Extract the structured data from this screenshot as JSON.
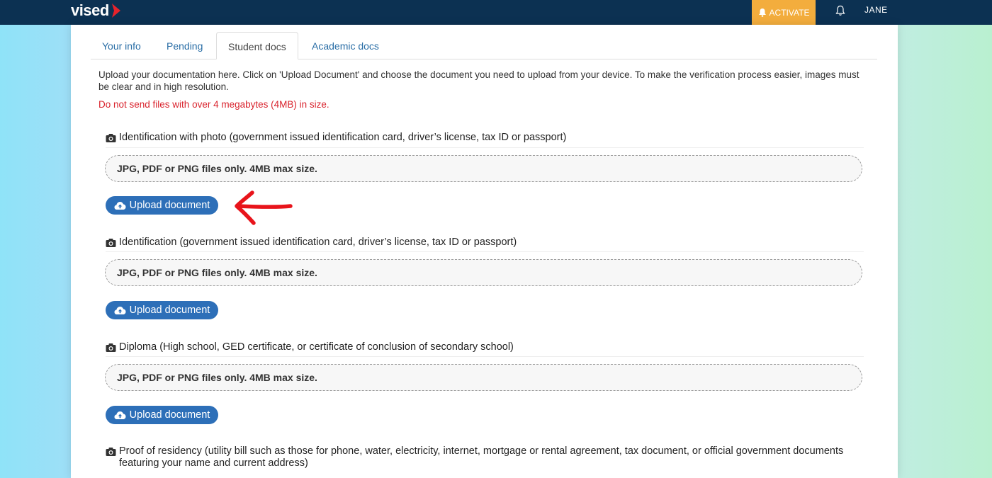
{
  "header": {
    "logo_text": "vised",
    "activate_label": "ACTIVATE",
    "user_name": "JANE"
  },
  "tabs": [
    {
      "label": "Your info",
      "active": false
    },
    {
      "label": "Pending",
      "active": false
    },
    {
      "label": "Student docs",
      "active": true
    },
    {
      "label": "Academic docs",
      "active": false
    }
  ],
  "intro": {
    "text": "Upload your documentation here. Click on 'Upload Document' and choose the document you need to upload from your device. To make the verification process easier, images must be clear and in high resolution.",
    "warning": "Do not send files with over 4 megabytes (4MB) in size."
  },
  "documents": [
    {
      "title": "Identification with photo (government issued identification card, driver’s license, tax ID or passport)",
      "dropzone": "JPG, PDF or PNG files only. 4MB max size.",
      "upload_label": "Upload document"
    },
    {
      "title": "Identification (government issued identification card, driver’s license, tax ID or passport)",
      "dropzone": "JPG, PDF or PNG files only. 4MB max size.",
      "upload_label": "Upload document"
    },
    {
      "title": "Diploma (High school, GED certificate, or certificate of conclusion of secondary school)",
      "dropzone": "JPG, PDF or PNG files only. 4MB max size.",
      "upload_label": "Upload document"
    },
    {
      "title": "Proof of residency (utility bill such as those for phone, water, electricity, internet, mortgage or rental agreement, tax document, or official government documents featuring your name and current address)"
    }
  ],
  "colors": {
    "topbar": "#0c3152",
    "activate": "#f3ad3d",
    "upload_button": "#2d6fb8",
    "warning": "#d9232d",
    "annotation_arrow": "#e8141b"
  },
  "icons": {
    "bell": "bell-icon",
    "camera": "camera-icon",
    "upload": "cloud-upload-icon",
    "logo_chevron": "chevron-right-icon"
  }
}
